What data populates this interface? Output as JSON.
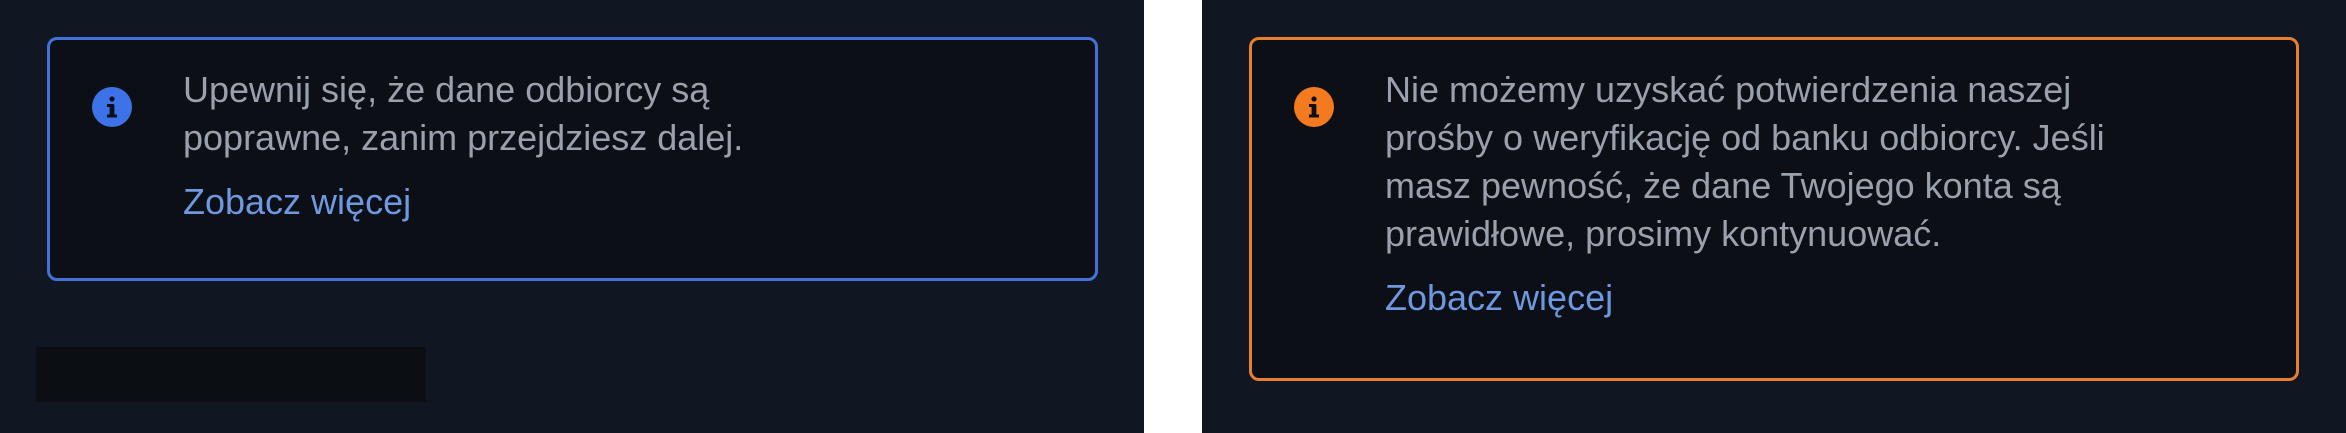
{
  "left_panel": {
    "alert": {
      "type": "info",
      "icon": "info-icon",
      "color": "#3d73e8",
      "message": "Upewnij się, że dane odbiorcy są\npoprawne, zanim przejdziesz dalej.",
      "link_label": "Zobacz więcej"
    }
  },
  "right_panel": {
    "alert": {
      "type": "warning",
      "icon": "info-icon",
      "color": "#f47a20",
      "message": "Nie możemy uzyskać potwierdzenia naszej\nprośby o weryfikację od banku odbiorcy. Jeśli\nmasz pewność, że dane Twojego konta są\nprawidłowe, prosimy kontynuować.",
      "link_label": "Zobacz więcej"
    }
  }
}
